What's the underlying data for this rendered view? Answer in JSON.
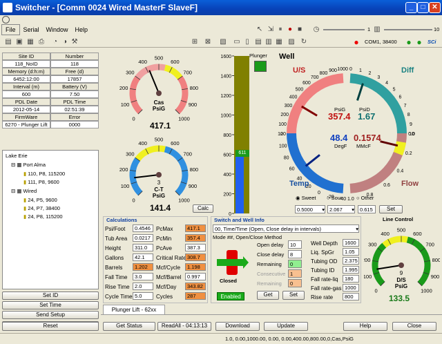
{
  "window": {
    "title": "Switcher - [Comm 0024 Wired MasterF SlaveF]"
  },
  "menu": [
    "File",
    "Serial",
    "Window",
    "Help"
  ],
  "toolbar": {
    "com": "COM1, 38400",
    "scale_left": "1",
    "scale_right": "10",
    "sci": "SCi"
  },
  "site": {
    "h1": "Site ID",
    "h2": "Number",
    "site_id": "118_NoID",
    "number": "118",
    "mem_h": "Memory (d:h:m)",
    "free_h": "Free (d)",
    "memory": "6452:12:00",
    "free": "17857",
    "int_h": "Interval (m)",
    "bat_h": "Battery (V)",
    "interval": "600",
    "battery": "7.50",
    "pdl_date_h": "PDL Date",
    "pdl_time_h": "PDL Time",
    "pdl_date": "2012-05-14",
    "pdl_time": "02:51:39",
    "fw_h": "FirmWare",
    "err_h": "Error",
    "firmware": "6270 - Plunger Lift",
    "error": "0000"
  },
  "tree": {
    "root": "Lake Erie",
    "g1": "Port Alma",
    "g1a": "110, P8, 115200",
    "g1b": "111, P8, 9600",
    "g2": "Wired",
    "g2a": "24, P5, 9600",
    "g2b": "24, P7, 38400",
    "g2c": "24, P8, 115200"
  },
  "left_buttons": {
    "set_id": "Set ID",
    "set_time": "Set Time",
    "send_setup": "Send Setup",
    "reset": "Reset"
  },
  "gauge_cas": {
    "label1": "Cas",
    "label2": "PsiG",
    "value": "417.1",
    "level": 417.1,
    "max": 1000,
    "ticks": [
      "0",
      "100",
      "200",
      "300",
      "400",
      "500",
      "600",
      "700",
      "800",
      "900",
      "1000"
    ]
  },
  "gauge_ct": {
    "label1": "C-T",
    "label2": "PsiG",
    "value": "141.4",
    "small": "3",
    "level": 141.4,
    "max": 1000,
    "ticks": [
      "0",
      "100",
      "200",
      "300",
      "400",
      "500",
      "600",
      "700",
      "800",
      "900",
      "1000"
    ]
  },
  "calc_btn": "Calc",
  "bar": {
    "ticks": [
      "1600",
      "1400",
      "1200",
      "1000",
      "800",
      "600",
      "400",
      "200",
      "0"
    ],
    "marker": "611",
    "plunger": "Plunger",
    "level": 611,
    "max": 1600
  },
  "well": {
    "title": "Well",
    "us": "U/S",
    "diff": "Diff",
    "temp": "Temp",
    "flow": "Flow",
    "psig_l": "PsiG",
    "psig": "357.4",
    "psid_l": "PsiD",
    "psid": "1.67",
    "degf_l": "DegF",
    "degf": "48.4",
    "mmcf_l": "MMcF",
    "mmcf": "0.1574",
    "us_ticks": [
      "0",
      "100",
      "200",
      "300",
      "400",
      "500",
      "600",
      "700",
      "800",
      "900",
      "1000"
    ],
    "diff_ticks": [
      "0",
      "1",
      "2",
      "3",
      "4",
      "5",
      "6",
      "7",
      "8",
      "9",
      "10"
    ],
    "temp_ticks": [
      "-40",
      "-20",
      "0",
      "20",
      "40",
      "60",
      "80",
      "100",
      "120"
    ],
    "flow_ticks": [
      "0.0",
      "0.2",
      "0.4",
      "0.6",
      "0.8",
      "1.0"
    ]
  },
  "gas": {
    "sweet": "Sweet",
    "sour": "Sour",
    "other": "Other",
    "v1": "0.5000",
    "v2": "2.067",
    "v3": "0.615",
    "set": "Set"
  },
  "calculations": {
    "title": "Calculations",
    "rows": [
      [
        "Psi/Foot",
        "0.4546",
        "PcMax",
        "417.1"
      ],
      [
        "Tub Area",
        "0.0217",
        "PcMin",
        "357.4"
      ],
      [
        "Height",
        "311.0",
        "PcAve",
        "387.3"
      ],
      [
        "Gallons",
        "42.1",
        "Critical Rate",
        "308.7"
      ],
      [
        "Barrels",
        "1.202",
        "Mcf/Cycle",
        "1.198"
      ],
      [
        "Fall Time",
        "3.0",
        "Mcf/Barrel",
        "0.997"
      ],
      [
        "Rise Time",
        "2.0",
        "Mcf/Day",
        "343.82"
      ],
      [
        "Cycle Time",
        "5.0",
        "Cycles",
        "287"
      ]
    ]
  },
  "switch": {
    "title": "Switch and Well Info",
    "mode_select": "00, Time/Time (Open, Close delay in intervals)",
    "mode_text": "Mode ##, Open/Close Method",
    "open_delay_l": "Open delay",
    "open_delay": "10",
    "close_delay_l": "Close delay",
    "close_delay": "8",
    "remaining_l": "Remaining",
    "remaining": "0",
    "consecutive_l": "Consecutive",
    "consecutive": "1",
    "remaining2_l": "Remaining",
    "remaining2": "0",
    "state": "Closed",
    "enabled": "Enabled",
    "get": "Get",
    "set": "Set",
    "well_rows": [
      [
        "Well Depth",
        "1600"
      ],
      [
        "Liq. SpGr",
        "1.05"
      ],
      [
        "Tubing OD",
        "2.375"
      ],
      [
        "Tubing ID",
        "1.995"
      ],
      [
        "Fall rate-liq",
        "180"
      ],
      [
        "Fall rate-gas",
        "1000"
      ],
      [
        "Rise rate",
        "800"
      ]
    ]
  },
  "line_control": {
    "title": "Line Control",
    "label1": "D/S",
    "label2": "PsiG",
    "value": "133.5",
    "small": "9",
    "level": 133.5,
    "max": 1000,
    "ticks": [
      "0",
      "100",
      "200",
      "300",
      "400",
      "500",
      "600",
      "700",
      "800",
      "900",
      "1000"
    ]
  },
  "tab": "Plunger Lift - 62xx",
  "bottom": {
    "get_status": "Get Status",
    "readall": "ReadAll - 04:13:13",
    "download": "Download",
    "update": "Update",
    "help": "Help",
    "close": "Close"
  },
  "status": "1.0, 0.00,1000.00, 0.00, 0.00,400.00,800.00,0,Cas,PsiG"
}
